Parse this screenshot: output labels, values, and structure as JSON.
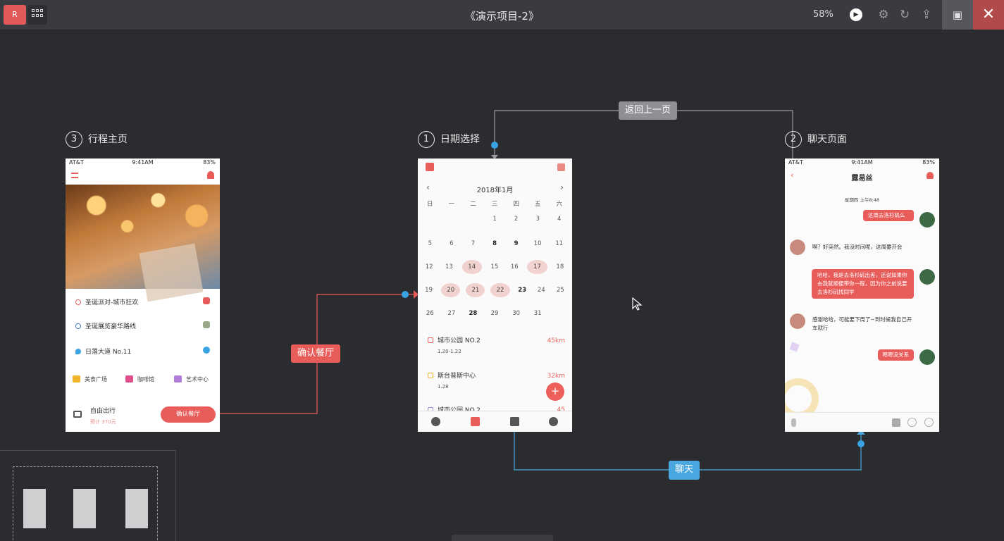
{
  "app": {
    "title": "《演示项目-2》",
    "logo_text": "R",
    "zoom": "58%"
  },
  "colors": {
    "accent_red": "#e85c5a",
    "link_blue": "#4aa8e0",
    "background": "#2b2c30"
  },
  "screens": {
    "trip": {
      "number": "3",
      "label": "行程主页",
      "status": {
        "carrier": "AT&T",
        "time": "9:41AM",
        "battery": "83%"
      },
      "items": [
        "圣诞派对-城市狂欢",
        "圣诞展览豪华路线",
        "日落大道 No.11"
      ],
      "categories": [
        "美食广场",
        "咖啡馆",
        "艺术中心"
      ],
      "trip_title": "自由出行",
      "trip_price": "预计 370元",
      "confirm_button": "确认餐厅"
    },
    "date": {
      "number": "1",
      "label": "日期选择",
      "month": "2018年1月",
      "weekdays": [
        "日",
        "一",
        "二",
        "三",
        "四",
        "五",
        "六"
      ],
      "weeks": [
        [
          "",
          "",
          "",
          "1",
          "2",
          "3",
          "4"
        ],
        [
          "5",
          "6",
          "7",
          "8",
          "9",
          "10",
          "11"
        ],
        [
          "12",
          "13",
          "14",
          "15",
          "16",
          "17",
          "18"
        ],
        [
          "19",
          "20",
          "21",
          "22",
          "23",
          "24",
          "25"
        ],
        [
          "26",
          "27",
          "28",
          "29",
          "30",
          "31",
          ""
        ]
      ],
      "events": [
        {
          "name": "城市公园 NO.2",
          "date": "1.20-1.22",
          "distance": "45km"
        },
        {
          "name": "斯台普斯中心",
          "date": "1.28",
          "distance": "32km"
        },
        {
          "name": "城市公园 NO.2",
          "date": "",
          "distance": "45"
        }
      ],
      "fab": "+"
    },
    "chat": {
      "number": "2",
      "label": "聊天页面",
      "status": {
        "carrier": "AT&T",
        "time": "9:41AM",
        "battery": "83%"
      },
      "name": "露易丝",
      "time": "星期四 上午8:48",
      "messages": [
        {
          "side": "right",
          "text": "这周去洛杉矶么"
        },
        {
          "side": "left",
          "text": "啊？好突然。我没时间呢，这周要开会"
        },
        {
          "side": "right",
          "text": "哈哈，我是去洛杉矶出差，还说如果你去我就顺便带你一程，因为你之前说要去洛杉矶找同学"
        },
        {
          "side": "left",
          "text": "感谢哈哈，可能要下周了~到时候我自己开车就行"
        },
        {
          "side": "right",
          "text": "嗯嗯没关系"
        }
      ]
    }
  },
  "connectors": {
    "back": "返回上一页",
    "confirm": "确认餐厅",
    "chat": "聊天"
  }
}
